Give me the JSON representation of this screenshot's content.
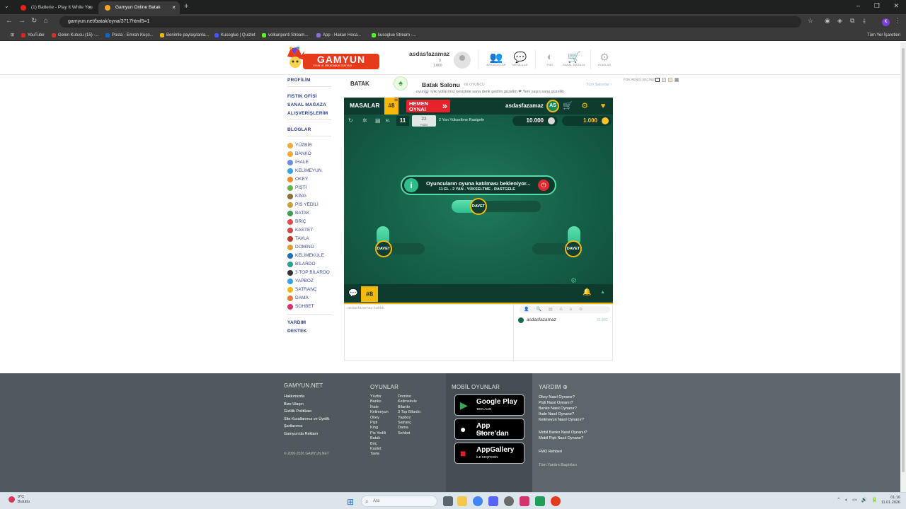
{
  "browser": {
    "tabs": [
      {
        "label": "(1) Batterie - Play It While You",
        "favicon_color": "#e62117"
      },
      {
        "label": "Gamyun Online Batak",
        "favicon_color": "#f5a623"
      }
    ],
    "url": "gamyun.net/batak/oyna/3717html5=1",
    "bookmarks": [
      {
        "label": "YouTube",
        "color": "#e62117"
      },
      {
        "label": "Gelen Kutusu (15) -...",
        "color": "#d93025"
      },
      {
        "label": "Posta - Emrah Kuşo...",
        "color": "#0a64d8"
      },
      {
        "label": "Benimle paylaşılanla...",
        "color": "#f4b400"
      },
      {
        "label": "Kusoglue | Quizlet",
        "color": "#4255ff"
      },
      {
        "label": "volkanponti Stream...",
        "color": "#53fc18"
      },
      {
        "label": "App - Hakan Hoca...",
        "color": "#8e6fd8"
      },
      {
        "label": "kusoglue Stream -...",
        "color": "#53fc18"
      }
    ],
    "all_bookmarks": "Tüm Yer İşaretleri",
    "profile_initial": "K"
  },
  "header": {
    "logo_text": "GAMYUN",
    "logo_sub": "OYUN VE ARKADAŞLIK DÜNYASI",
    "username": "asdasfazamaz",
    "stat1": "0",
    "stat2": "1.000",
    "icons": [
      {
        "label": "ARKADAŞLAR",
        "icon": "friends-icon",
        "glyph": "👥"
      },
      {
        "label": "MESAJLAR",
        "icon": "messages-icon",
        "glyph": "💬"
      },
      {
        "label": "FMO",
        "icon": "fmo-icon",
        "glyph": "◐"
      },
      {
        "label": "SANAL MAĞAZA",
        "icon": "cart-icon",
        "glyph": "🛒"
      },
      {
        "label": "AYARLAR",
        "icon": "gear-icon",
        "glyph": "⚙"
      }
    ]
  },
  "sidebar": {
    "profile": "PROFİLİM",
    "shop1": "FISTIK OFİSİ",
    "shop2": "SANAL MAĞAZA",
    "shop3": "ALIŞVERİŞLERİM",
    "blogs": "BLOGLAR",
    "games": [
      {
        "label": "YÜZBİR",
        "color": "#f2a93b"
      },
      {
        "label": "BANKO",
        "color": "#f2a93b"
      },
      {
        "label": "İHALE",
        "color": "#6b8fd6"
      },
      {
        "label": "KELİMEYUN",
        "color": "#3aa0e0"
      },
      {
        "label": "OKEY",
        "color": "#f28c28"
      },
      {
        "label": "PİŞTİ",
        "color": "#66b34a"
      },
      {
        "label": "KİNG",
        "color": "#8a6d3b"
      },
      {
        "label": "PİS YEDİLİ",
        "color": "#c8a13a"
      },
      {
        "label": "BATAK",
        "color": "#3a9d4f"
      },
      {
        "label": "BRİÇ",
        "color": "#e04a4a"
      },
      {
        "label": "KASTET",
        "color": "#d04545"
      },
      {
        "label": "TAVLA",
        "color": "#c0392b"
      },
      {
        "label": "DOMİNO",
        "color": "#e0a030"
      },
      {
        "label": "KELİMEKULE",
        "color": "#1f6fb5"
      },
      {
        "label": "BİLARDO",
        "color": "#2a9d8f"
      },
      {
        "label": "3 TOP BİLARDO",
        "color": "#333333"
      },
      {
        "label": "YAPBOZ",
        "color": "#3aa0e0"
      },
      {
        "label": "SATRANÇ",
        "color": "#f5b90b"
      },
      {
        "label": "DAMA",
        "color": "#e07b39"
      },
      {
        "label": "SOHBET",
        "color": "#d6336c"
      }
    ],
    "help": "YARDIM",
    "support": "DESTEK"
  },
  "game_header": {
    "title": "BATAK",
    "salon_title": "Batak Salonu",
    "player_count": "66 OYUNCU",
    "all_salons": "Tüm Salonlar ›",
    "marquee": "oyun🎡 İyiki yollarımız kesiştide sana denk geldim güzelim ❤ Yeni yaşın sana güzellik"
  },
  "table": {
    "masalar": "MASALAR",
    "table_no": "#8",
    "hemen": "HEMEN",
    "oyna": "OYNA!",
    "user": "asdasfazamaz",
    "initials": "AS",
    "el_label": "EL",
    "round": "11",
    "points": "22",
    "points_label": "PUAN",
    "mode": "2 Yan Yükseltme Rastgele",
    "bet": "10.000",
    "gold": "1.000",
    "seat_label": "DAVET",
    "wait_title": "Oyuncuların oyuna katılması bekleniyor...",
    "wait_sub": "11 EL - 2 YAN - YÜKSELTME - RASTGELE",
    "player_name": "asdasfazam",
    "bottom_no": "#8",
    "accent": "#f5b90b"
  },
  "chat": {
    "message": "asdasfazamaz katıldı",
    "player": "asdasfazamaz",
    "player_value": "10.000"
  },
  "fon": {
    "label": "FON RENGİ SEÇİNİZ:",
    "swatches": [
      "#ffffff",
      "#e8e8e8",
      "#f3eac8",
      "#9a9a9a"
    ]
  },
  "footer": {
    "c1_title": "GAMYUN.NET",
    "c1_links": [
      "Hakkımızda",
      "Bize Ulaşın",
      "Gizlilik Politikası",
      "Site Kurallarımız ve Üyelik",
      "Şartlarımız",
      "Gamyun'da Reklam"
    ],
    "copyright": "© 2000-2026 GAMYUN.NET",
    "c2_title": "OYUNLAR",
    "games_a": "Yüzbir\nBanko\nİhale\nKelimeyun\nOkey\nPişti\nKing\nPis Yedili\nBatak\nBriç\nKastet\nTavla",
    "games_b": "Domino\nKelimekule\nBilardo\n3 Top Bilardo\nYapboz\nSatranç\nDama\nSohbet",
    "c3_title": "MOBİL OYUNLAR",
    "stores": [
      {
        "big": "Google Play",
        "small": "'DEN ALIN",
        "glyph": "▶"
      },
      {
        "big": "App Store'dan",
        "small": "İndirin",
        "glyph": "●"
      },
      {
        "big": "AppGallery",
        "small": "İLE KEŞFEDİN",
        "glyph": "■"
      }
    ],
    "c4_title": "YARDIM",
    "help_links": [
      "Okey Nasıl Oynanır?",
      "Pişti Nasıl Oynanır?",
      "Banko Nasıl Oynanır?",
      "İhale Nasıl Oynanır?",
      "Kelimeyun Nasıl Oynanır?",
      "Mobil Banko Nasıl Oynanır?",
      "Mobil Pişti Nasıl Oynanır?",
      "FMO Rehberi",
      "Tüm Yardım Başlıkları"
    ]
  },
  "taskbar": {
    "temp": "9°C",
    "weather": "Bulutlu",
    "search": "Ara",
    "time": "01:16",
    "date": "11.01.2026"
  }
}
